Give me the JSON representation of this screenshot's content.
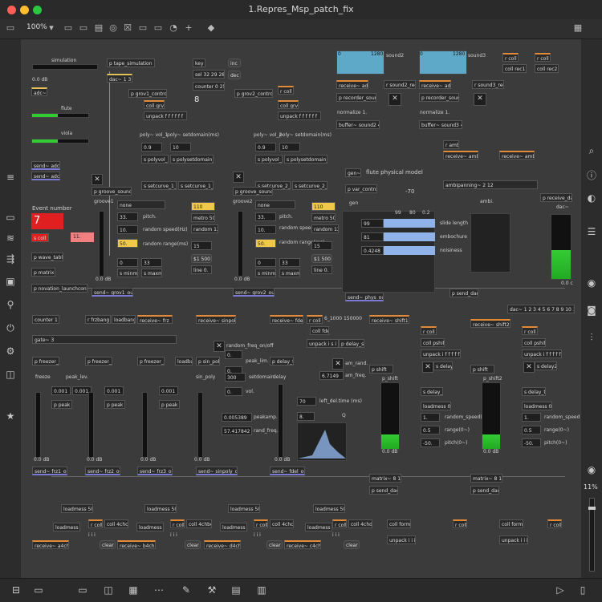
{
  "window": {
    "title": "1.Repres_Msp_patch_fix"
  },
  "toolbar": {
    "zoom": "100%"
  },
  "canvas": {
    "simulation": {
      "label": "simulation",
      "db": "0.0 dB",
      "tape": "p tape_simulation",
      "dac": "dac~ 1 3",
      "adc": "adc~",
      "flute": "flute",
      "viola": "viola",
      "send1": "send~ adc1",
      "send2": "send~ adc2"
    },
    "key": {
      "key": "key",
      "inc": "inc",
      "dec": "dec",
      "sel": "sel 32 29 28",
      "counter": "counter 0 25",
      "value": "8"
    },
    "grov1": {
      "control": "p grov1_control",
      "coll": "coll grv_1",
      "unpack": "unpack f f f f f f",
      "polyvol": "poly~ vol_1",
      "polyset": "poly~ setdomain(ms)",
      "n1": "0.9",
      "n2": "10",
      "poly1": "s polyvol_1",
      "polyset1": "s polysetdomain_1",
      "setcurve": "s setcurve_1_1",
      "setcurve2": "s setcurve_1_2",
      "groove": "p groove_sound2",
      "groove1": "groove1",
      "none": "none",
      "pitch": "pitch.",
      "n33": "33.",
      "n50": "50.",
      "rspeed": "random speed(Hz)",
      "rrange": "random range(ms)",
      "minm": "s minm_1",
      "maxm": "s maxm_1",
      "nr33": "33",
      "db": "0.0 dB",
      "send": "send~ grov1_out"
    },
    "grov2": {
      "control": "p grov2_control",
      "coll": "coll grv_2",
      "unpack": "unpack f f f f f f",
      "polyvol": "poly~ vol_2",
      "polyset": "poly~ setdomain(ms)",
      "n1": "0.9",
      "n2": "10",
      "poly1": "s polyvol_2",
      "polyset1": "s polysetdomain_2",
      "setcurve": "s setcurve_2_1",
      "setcurve2": "s setcurve_2_2",
      "groove": "p groove_sound3",
      "groove1": "groove2",
      "none": "none",
      "pitch": "pitch.",
      "n33": "33.",
      "n50": "50.",
      "rspeed": "random speed(Hz)",
      "rrange": "random range(ms)",
      "minm": "s minm_2",
      "maxm": "s maxm_2",
      "nr33": "33",
      "db": "0.0 dB",
      "send": "send~ grov2_out"
    },
    "metro1": {
      "n110": "110",
      "metro": "metro 500",
      "random": "random 127",
      "n15": "15",
      "line": "$1 500",
      "line0": "line 0."
    },
    "metro2": {
      "n110": "110",
      "metro": "metro 500",
      "random": "random 127",
      "n15": "15",
      "line": "$1 500",
      "line0": "line 0."
    },
    "event": {
      "label": "Event number",
      "value": "7",
      "coll": "s coll",
      "n11": "11.",
      "wavetable": "p wave_table",
      "matrix": "p matrix",
      "novation": "p novation_launchcontrol"
    },
    "sound2": {
      "label": "sound2",
      "t0": "0",
      "t1": "1280",
      "receive": "receive~ adc1",
      "rec": "r sound2_rec",
      "recorder": "p recorder_sound2",
      "normalize": "normalize 1.",
      "buffer": "buffer~ sound2 4000"
    },
    "sound3": {
      "label": "sound3",
      "t0": "0",
      "t1": "1280",
      "receive": "receive~ adc2",
      "rec": "r sound3_rec",
      "recorder": "p recorder_sound3",
      "normalize": "normalize 1.",
      "buffer": "buffer~ sound3 4000"
    },
    "rcoll": {
      "r1": "r coll",
      "r2": "r coll",
      "c1": "coll rec1",
      "c2": "coll rec2"
    },
    "ambi": {
      "rambi": "r ambi",
      "recv1": "receive~ ambi1",
      "recv2": "receive~ ambi2",
      "panning": "ambipanning~ 2 12",
      "label": "ambi.",
      "dac": "p receive_dac",
      "dacl": "dac~",
      "send": "p send_dac",
      "db": "0.0 c",
      "dac2": "dac~ 1 2 3 4 5 6 7 8 9 10 11 12"
    },
    "flute": {
      "gen": "gen~",
      "title": "flute physical model",
      "var": "p var_control",
      "neg70": "-70",
      "gen2": "gen",
      "n99": "99",
      "n80": "80",
      "n02": "0.2",
      "slen": "slide length",
      "n81": "81",
      "emb": "embochure",
      "n0": "0.4248",
      "noise": "noisiness",
      "send": "send~ phys_out"
    },
    "row2": {
      "counter": "counter 1 3",
      "frz": "r frzbang",
      "loadbang": "loadbang",
      "recvfrz": "receive~ frz_in",
      "gate": "gate~ 3",
      "f1": "p freezer_1",
      "f2": "p freezer_2",
      "f3": "p freezer_3",
      "freeze": "freeze",
      "peaklev": "peak_lev.",
      "v001": "0.001",
      "peak": "p peak",
      "db": "0.0 dB",
      "s1": "send~ frz1_out",
      "s2": "send~ frz2_out",
      "s3": "send~ frz3_out"
    },
    "sinpoly": {
      "recv": "receive~ sinpoly_in",
      "loadban": "loadban",
      "sin": "p sin_poly",
      "sinpol": "sin_poly",
      "rfreq": "random_freq_on/off",
      "peaklim": "peak_lim.",
      "n0": "0.",
      "n300": "300",
      "setdom": "setdomain.",
      "vol": "vol.",
      "v1": "0.005389",
      "peakamp": "peakamp.",
      "v2": "57.417842",
      "randfreq": "rand_freq.",
      "send": "send~ sinpoly_out"
    },
    "fdel": {
      "recv": "receive~ fdel_in",
      "rcoll": "r coll",
      "range": "6_1000 150000",
      "coll": "coll fdel",
      "unpack": "unpack i s i s",
      "pdelsend": "p delay_send",
      "pdelay": "p delay_fill",
      "delay": "delay",
      "amrand": "am_rand.",
      "n6": "6.7149",
      "amfreq": "am_freq.",
      "n70": "70",
      "ldel": "left_del.time (ms)",
      "n8": "8.",
      "q": "Q",
      "db": "0.0 dB",
      "send": "send~ fdel_out"
    },
    "shift1": {
      "recv": "receive~ shift1_in",
      "rcoll": "r coll",
      "coll": "coll pshift1",
      "unpack": "unpack i f f f f f",
      "pshift": "p shift",
      "label": "p_shift",
      "sdelay": "s delay",
      "delay1": "s delay_t",
      "loadmess": "loadmess 0.5",
      "n1": "1.",
      "n05": "0.5",
      "n50": "-50.",
      "rspeed": "random_speed(Hz)",
      "range": "range(0~)",
      "pitch": "pitch(0~)",
      "db": "0.0 dB"
    },
    "shift2": {
      "recv": "receive~ shift2_in",
      "rcoll": "r coll",
      "coll": "coll pshift2",
      "unpack": "unpack i f f f f f",
      "pshift": "p shift",
      "label": "p_shift2",
      "sdelay": "s delay2",
      "delay1": "s delay_t2",
      "loadmess": "loadmess 0.5",
      "n1": "1.",
      "n05": "0.5",
      "n50": "-50.",
      "rspeed": "random_speed",
      "range": "range(0~)",
      "pitch": "pitch(0~)",
      "db": "0.0 dB"
    },
    "matrix": {
      "m1": "matrix~ 8 12",
      "m2": "matrix~ 8 12",
      "dac1": "p send_dac",
      "dac2": "p send_dac"
    },
    "bottomrow": {
      "lm1": "loadmess 500",
      "lm2": "loadmess 500",
      "lm3": "loadmess 500",
      "lm4": "loadmess 500",
      "l1": "loadmess 1",
      "l2": "loadmess 1",
      "l3": "loadmess 1",
      "l4": "loadmess 1",
      "rcoll": "r coll",
      "c1": "coll 4chcl",
      "c2": "coll 4chbcl",
      "c3": "coll 4chcl",
      "c4": "coll 4chdd",
      "cform1": "coll form1",
      "cform3": "coll form3",
      "rcoll2": "r coll",
      "unpack": "unpack i i i",
      "unpack2": "unpack i i i",
      "clear": "clear",
      "iii": "i i i",
      "r1": "receive~ a4ch_in",
      "r2": "receive~ b4ch_in",
      "r3": "receive~ c4ch_in",
      "r4": "receive~ d4ch_in"
    }
  },
  "rightpanel": {
    "percent": "11%"
  }
}
